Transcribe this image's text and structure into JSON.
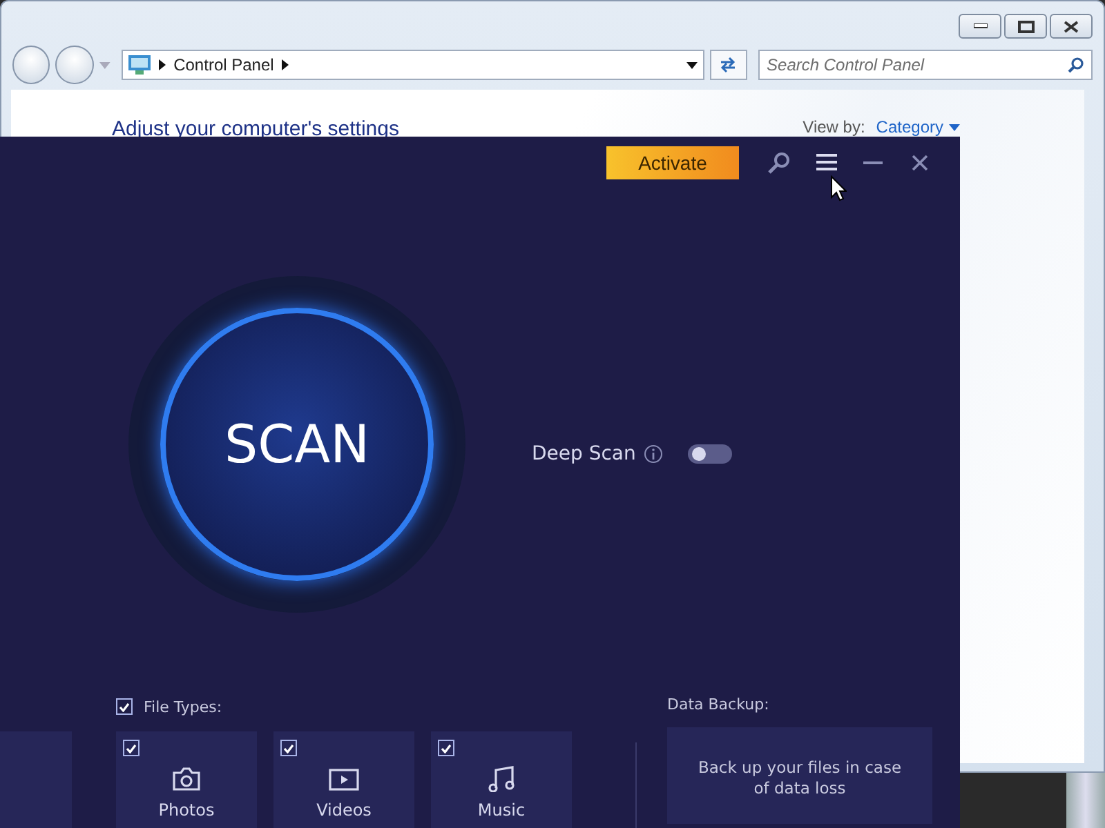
{
  "explorer": {
    "breadcrumb": "Control Panel",
    "search": {
      "placeholder": "Search Control Panel"
    },
    "heading": "Adjust your computer's settings",
    "view_by": {
      "label": "View by:",
      "value": "Category"
    }
  },
  "app": {
    "activate_button": "Activate",
    "scan_button": "SCAN",
    "deep_scan": {
      "label": "Deep Scan",
      "on": false
    },
    "file_types": {
      "label": "File Types:",
      "checked": true,
      "items": [
        {
          "kind": "photos",
          "label": "Photos",
          "checked": true
        },
        {
          "kind": "videos",
          "label": "Videos",
          "checked": true
        },
        {
          "kind": "music",
          "label": "Music",
          "checked": true
        }
      ]
    },
    "data_backup": {
      "label": "Data Backup:",
      "description": "Back up your files in case of data loss"
    }
  }
}
